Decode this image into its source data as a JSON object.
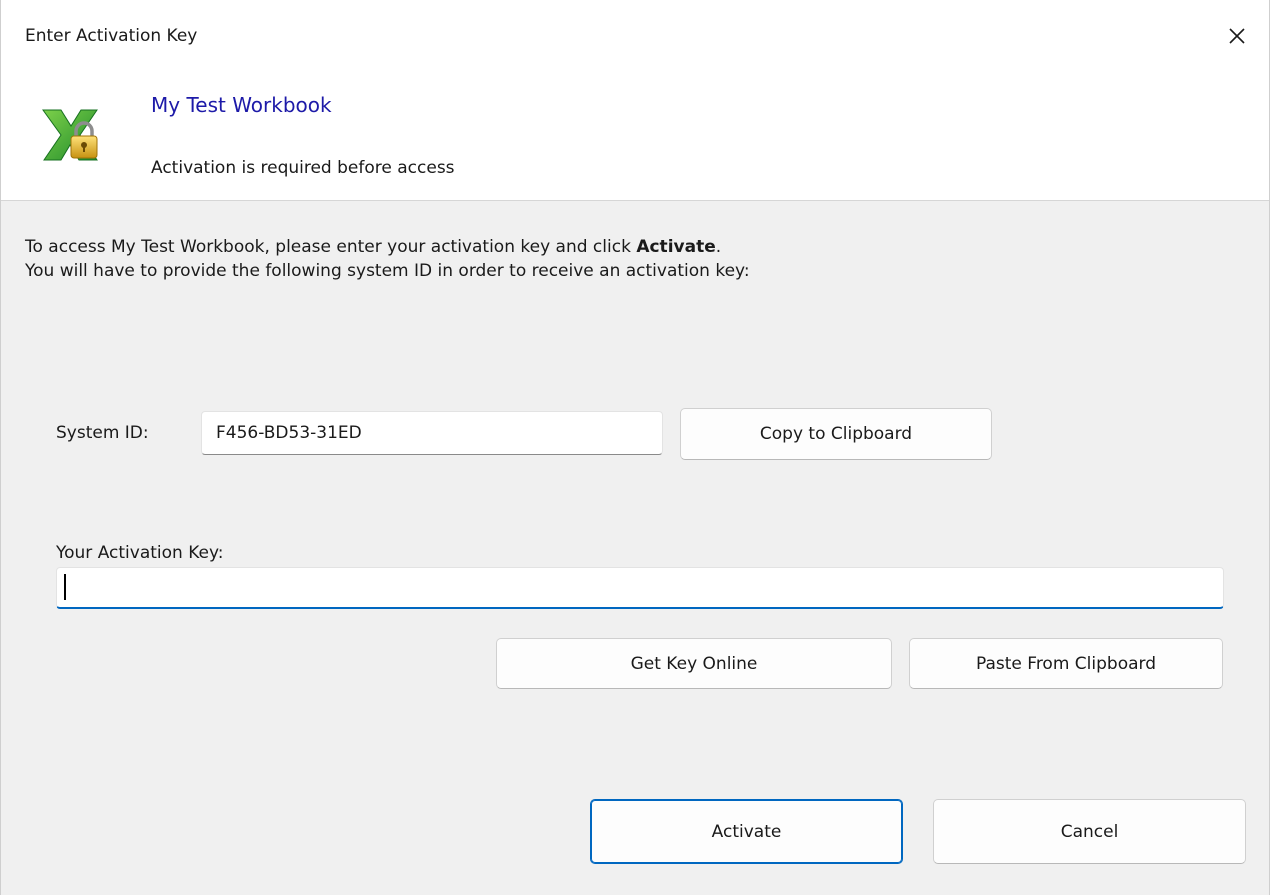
{
  "window": {
    "title": "Enter Activation Key"
  },
  "header": {
    "product_name": "My Test Workbook",
    "subtitle": "Activation is required before access",
    "icon": "excel-lock-icon"
  },
  "instructions": {
    "line1_prefix": "To access My Test Workbook, please enter your activation key and click ",
    "line1_bold": "Activate",
    "line1_suffix": ".",
    "line2": "You will have to provide the following system ID in order to receive an activation key:"
  },
  "system_id": {
    "label": "System ID:",
    "value": "F456-BD53-31ED",
    "copy_button": "Copy to Clipboard"
  },
  "activation_key": {
    "label": "Your Activation Key:",
    "value": "",
    "get_key_button": "Get Key Online",
    "paste_button": "Paste From Clipboard"
  },
  "footer": {
    "activate_button": "Activate",
    "cancel_button": "Cancel"
  },
  "colors": {
    "accent": "#0067c0",
    "product_name": "#1d1aa8",
    "content_background": "#f0f0f0"
  }
}
